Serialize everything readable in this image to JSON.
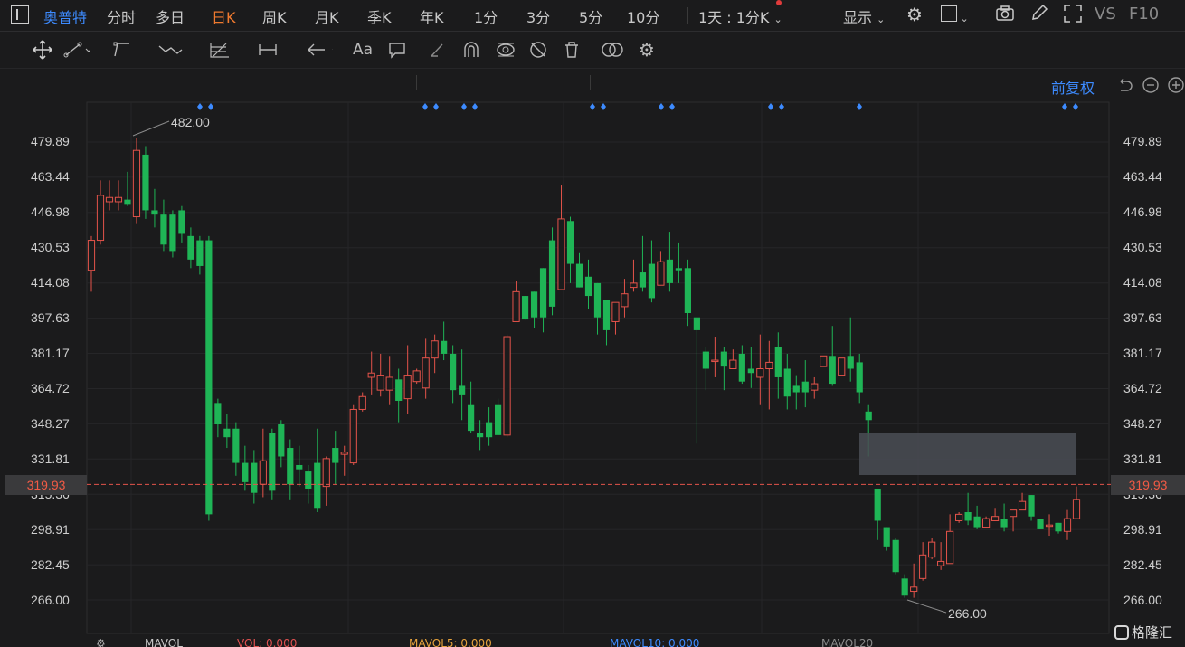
{
  "header": {
    "stock_name": "奥普特",
    "tabs": [
      "分时",
      "多日",
      "日K",
      "周K",
      "月K",
      "季K",
      "年K",
      "1分",
      "3分",
      "5分",
      "10分"
    ],
    "active_tab": "日K",
    "period_select": "1天 : 1分K",
    "display_label": "显示",
    "vs_label": "VS",
    "f10_label": "F10"
  },
  "toolbar": {
    "text_tool_label": "Aa"
  },
  "chart": {
    "adjust_label": "前复权",
    "y_ticks": [
      "479.89",
      "463.44",
      "446.98",
      "430.53",
      "414.08",
      "397.63",
      "381.17",
      "364.72",
      "348.27",
      "331.81",
      "315.36",
      "298.91",
      "282.45",
      "266.00"
    ],
    "current_price": "319.93",
    "high_label": "482.00",
    "low_label": "266.00"
  },
  "chart_data": {
    "type": "candlestick",
    "y_range": [
      266.0,
      479.89
    ],
    "current_price": 319.93,
    "high": 482.0,
    "low": 266.0,
    "candles": [
      [
        420,
        434,
        410,
        436
      ],
      [
        434,
        455,
        432,
        462
      ],
      [
        452,
        454,
        448,
        462
      ],
      [
        452,
        454,
        448,
        462
      ],
      [
        453,
        451,
        450,
        466
      ],
      [
        445,
        476,
        442,
        482
      ],
      [
        474,
        448,
        444,
        478
      ],
      [
        448,
        446,
        440,
        458
      ],
      [
        446,
        432,
        429,
        453
      ],
      [
        446,
        429,
        426,
        448
      ],
      [
        448,
        437,
        433,
        450
      ],
      [
        436,
        425,
        421,
        440
      ],
      [
        434,
        422,
        418,
        436
      ],
      [
        434,
        306,
        303,
        436
      ],
      [
        358,
        348,
        342,
        360
      ],
      [
        346,
        342,
        337,
        353
      ],
      [
        346,
        330,
        324,
        349
      ],
      [
        330,
        321,
        317,
        338
      ],
      [
        330,
        316,
        311,
        336
      ],
      [
        320,
        331,
        314,
        346
      ],
      [
        344,
        317,
        313,
        346
      ],
      [
        348,
        333,
        328,
        350
      ],
      [
        337,
        320,
        313,
        341
      ],
      [
        329,
        327,
        319,
        338
      ],
      [
        326,
        318,
        311,
        329
      ],
      [
        330,
        309,
        307,
        346
      ],
      [
        319,
        332,
        310,
        333
      ],
      [
        337,
        330,
        320,
        345
      ],
      [
        334,
        335,
        324,
        338
      ],
      [
        330,
        355,
        329,
        357
      ],
      [
        355,
        361,
        354,
        363
      ],
      [
        370,
        372,
        362,
        382
      ],
      [
        364,
        371,
        361,
        381
      ],
      [
        364,
        370,
        357,
        380
      ],
      [
        369,
        359,
        349,
        374
      ],
      [
        360,
        371,
        353,
        385
      ],
      [
        368,
        373,
        367,
        374
      ],
      [
        365,
        379,
        360,
        388
      ],
      [
        379,
        387,
        372,
        390
      ],
      [
        387,
        381,
        378,
        396
      ],
      [
        381,
        364,
        358,
        385
      ],
      [
        366,
        362,
        350,
        383
      ],
      [
        357,
        345,
        344,
        368
      ],
      [
        344,
        342,
        336,
        350
      ],
      [
        349,
        342,
        338,
        356
      ],
      [
        357,
        343,
        344,
        360
      ],
      [
        343,
        389,
        342,
        390
      ],
      [
        396,
        410,
        405,
        415
      ],
      [
        408,
        397,
        406,
        408
      ],
      [
        410,
        398,
        393,
        408
      ],
      [
        421,
        398,
        391,
        421
      ],
      [
        434,
        403,
        399,
        440
      ],
      [
        411,
        444,
        415,
        460
      ],
      [
        443,
        423,
        414,
        445
      ],
      [
        423,
        412,
        417,
        428
      ],
      [
        417,
        408,
        402,
        425
      ],
      [
        414,
        398,
        390,
        414
      ],
      [
        406,
        392,
        385,
        404
      ],
      [
        396,
        405,
        390,
        404
      ],
      [
        403,
        409,
        398,
        416
      ],
      [
        412,
        414,
        410,
        425
      ],
      [
        419,
        412,
        410,
        436
      ],
      [
        423,
        407,
        405,
        434
      ],
      [
        413,
        424,
        420,
        429
      ],
      [
        425,
        414,
        410,
        438
      ],
      [
        421,
        420,
        414,
        433
      ],
      [
        421,
        400,
        394,
        425
      ],
      [
        398,
        392,
        339,
        397
      ],
      [
        382,
        374,
        364,
        384
      ],
      [
        378,
        378,
        370,
        389
      ],
      [
        382,
        375,
        364,
        384
      ],
      [
        374,
        378,
        377,
        383
      ],
      [
        381,
        368,
        367,
        385
      ],
      [
        374,
        372,
        365,
        384
      ],
      [
        370,
        374,
        357,
        390
      ],
      [
        374,
        377,
        355,
        387
      ],
      [
        384,
        370,
        360,
        391
      ],
      [
        374,
        361,
        355,
        381
      ],
      [
        366,
        363,
        355,
        371
      ],
      [
        368,
        363,
        356,
        378
      ],
      [
        364,
        367,
        360,
        370
      ],
      [
        375,
        380,
        380,
        380
      ],
      [
        380,
        367,
        366,
        394
      ],
      [
        371,
        379,
        374,
        374
      ],
      [
        380,
        374,
        368,
        398
      ],
      [
        377,
        363,
        358,
        381
      ],
      [
        354,
        350,
        333,
        357
      ],
      [
        318,
        303,
        294,
        318
      ],
      [
        300,
        291,
        289,
        299
      ],
      [
        294,
        279,
        278,
        295
      ],
      [
        276,
        268,
        267,
        278
      ],
      [
        270,
        272,
        267,
        283
      ],
      [
        276,
        287,
        275,
        293
      ],
      [
        286,
        293,
        285,
        295
      ],
      [
        282,
        284,
        280,
        293
      ],
      [
        283,
        298,
        298,
        306
      ],
      [
        303,
        306,
        302,
        307
      ],
      [
        307,
        303,
        301,
        316
      ],
      [
        305,
        300,
        299,
        310
      ],
      [
        300,
        304,
        303,
        305
      ],
      [
        303,
        305,
        303,
        309
      ],
      [
        304,
        300,
        298,
        311
      ],
      [
        305,
        308,
        298,
        308
      ],
      [
        308,
        312,
        310,
        316
      ],
      [
        315,
        305,
        303,
        315
      ],
      [
        304,
        299,
        299,
        303
      ],
      [
        301,
        301,
        296,
        306
      ],
      [
        302,
        298,
        297,
        301
      ],
      [
        298,
        304,
        294,
        308
      ],
      [
        304,
        313,
        305,
        319
      ]
    ]
  },
  "indicators": {
    "vol_label": "MAVOL",
    "vol_value": "VOL: 0.000",
    "ma5": "MAVOL5: 0.000",
    "ma10": "MAVOL10: 0.000",
    "ma20": "MAVOL20"
  },
  "watermark": {
    "text": "格隆汇"
  }
}
